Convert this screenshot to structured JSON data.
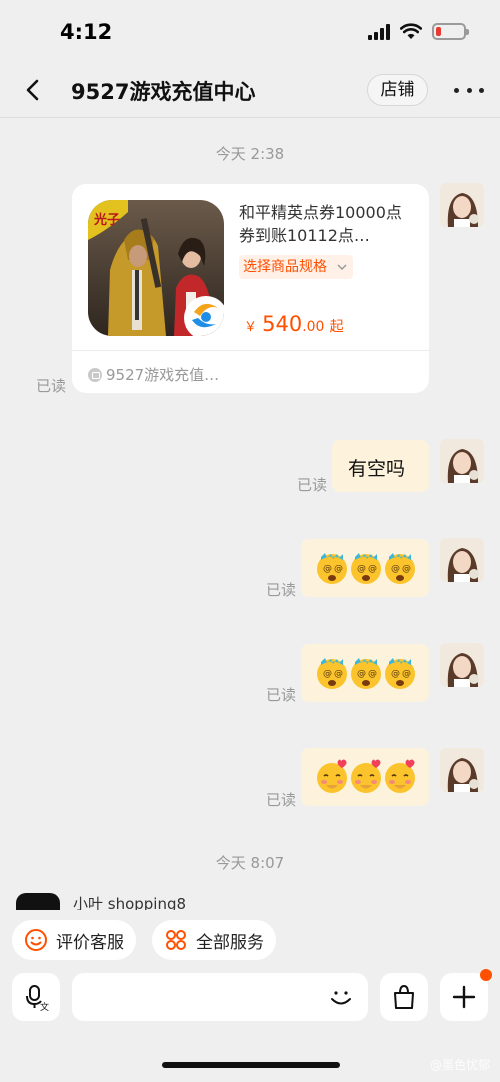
{
  "status_bar": {
    "time": "4:12",
    "battery_level": 0.18,
    "colors": {
      "battery_low": "#e83a30"
    }
  },
  "nav": {
    "title": "9527游戏充值中心",
    "store_label": "店铺",
    "icons": [
      "chevron-left-icon",
      "more-icon"
    ]
  },
  "chat": {
    "timestamp_1": "今天 2:38",
    "product_card": {
      "title": "和平精英点券10000点券到账10112点…",
      "spec_label": "选择商品规格",
      "price_currency": "￥",
      "price_int": "540",
      "price_dec": ".00",
      "price_suffix": "起",
      "shop_name": "9527游戏充值…",
      "read_label": "已读"
    },
    "messages": [
      {
        "type": "text",
        "text": "有空吗",
        "read_label": "已读"
      },
      {
        "type": "emoji",
        "emojis": [
          "dizzy-face-emoji",
          "dizzy-face-emoji",
          "dizzy-face-emoji"
        ],
        "read_label": "已读"
      },
      {
        "type": "emoji",
        "emojis": [
          "dizzy-face-emoji",
          "dizzy-face-emoji",
          "dizzy-face-emoji"
        ],
        "read_label": "已读"
      },
      {
        "type": "emoji",
        "emojis": [
          "blushing-face-emoji",
          "blushing-face-emoji",
          "blushing-face-emoji"
        ],
        "read_label": "已读"
      }
    ],
    "timestamp_2": "今天 8:07",
    "partial_sender": "小叶 shopping8"
  },
  "quick_actions": {
    "review_label": "评价客服",
    "services_label": "全部服务"
  },
  "input_bar": {
    "icons": [
      "voice-translate-icon",
      "smile-icon",
      "shopping-bag-icon",
      "plus-icon"
    ]
  },
  "watermark": "@墨色忧郁",
  "colors": {
    "accent": "#ff5000",
    "bubble": "#fdf3dc",
    "background": "#efefef"
  }
}
